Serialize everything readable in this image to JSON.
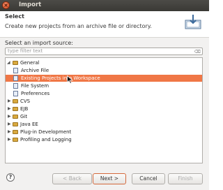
{
  "window": {
    "title": "Import"
  },
  "header": {
    "title": "Select",
    "description": "Create new projects from an archive file or directory."
  },
  "source": {
    "label": "Select an import source:",
    "filter_placeholder": "type filter text"
  },
  "tree": {
    "items": [
      {
        "label": "General",
        "type": "folder",
        "expanded": true
      },
      {
        "label": "Archive File",
        "type": "item"
      },
      {
        "label": "Existing Projects into Workspace",
        "type": "item",
        "selected": true
      },
      {
        "label": "File System",
        "type": "item"
      },
      {
        "label": "Preferences",
        "type": "item"
      },
      {
        "label": "CVS",
        "type": "folder"
      },
      {
        "label": "EJB",
        "type": "folder"
      },
      {
        "label": "Git",
        "type": "folder"
      },
      {
        "label": "Java EE",
        "type": "folder"
      },
      {
        "label": "Plug-in Development",
        "type": "folder"
      },
      {
        "label": "Profiling and Logging",
        "type": "folder"
      }
    ]
  },
  "buttons": {
    "back": "< Back",
    "next": "Next >",
    "cancel": "Cancel",
    "finish": "Finish"
  },
  "colors": {
    "selection": "#f07746",
    "folder": "#d9a93f"
  }
}
